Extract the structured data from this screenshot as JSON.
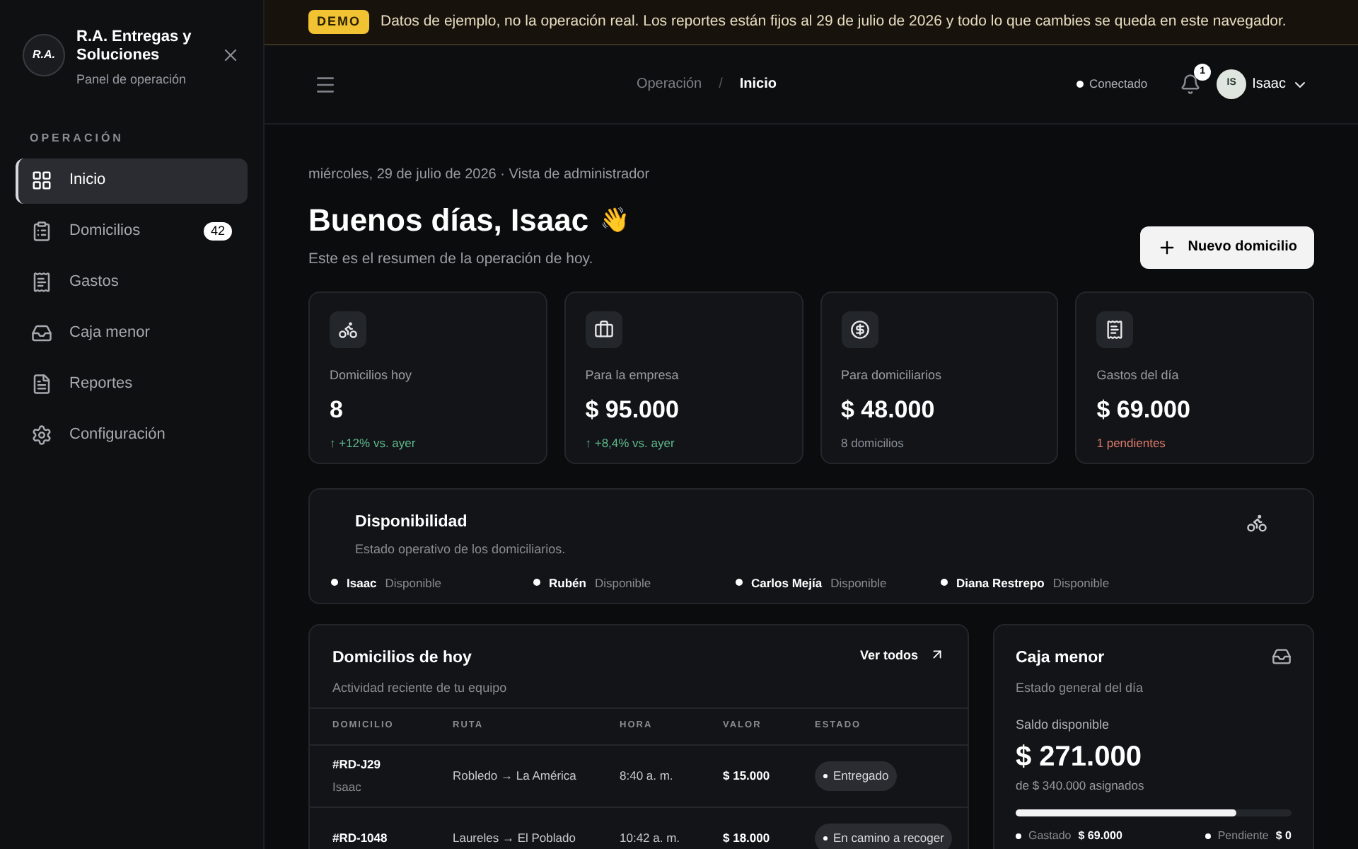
{
  "brand": {
    "name": "R.A. Entregas y Soluciones",
    "subtitle": "Panel de operación",
    "logo_text": "R.A."
  },
  "sidebar": {
    "section": "OPERACIÓN",
    "items": [
      {
        "label": "Inicio",
        "selected": true
      },
      {
        "label": "Domicilios",
        "selected": false,
        "badge": "42"
      },
      {
        "label": "Gastos",
        "selected": false
      },
      {
        "label": "Caja menor",
        "selected": false
      },
      {
        "label": "Reportes",
        "selected": false
      },
      {
        "label": "Configuración",
        "selected": false
      }
    ]
  },
  "banner": {
    "tag": "DEMO",
    "text": "Datos de ejemplo, no la operación real. Los reportes están fijos al 29 de julio de 2026 y todo lo que cambies se queda en este navegador."
  },
  "header": {
    "breadcrumb": [
      "Operación",
      "Inicio"
    ],
    "separator": "/",
    "status": "Conectado",
    "notifications": "1",
    "user_initials": "IS",
    "user_name": "Isaac"
  },
  "greeting": {
    "date": "miércoles, 29 de julio de 2026 · Vista de administrador",
    "title": "Buenos días, Isaac",
    "emoji": "👋",
    "subtitle": "Este es el resumen de la operación de hoy.",
    "button": "Nuevo domicilio"
  },
  "stats": [
    {
      "label": "Domicilios hoy",
      "value": "8",
      "note": "↑ +12% vs. ayer",
      "color": "#5fb88a"
    },
    {
      "label": "Para la empresa",
      "value": "$ 95.000",
      "note": "↑ +8,4% vs. ayer",
      "color": "#5fb88a"
    },
    {
      "label": "Para domiciliarios",
      "value": "$ 48.000",
      "note": "8 domicilios",
      "color": "#8a8f98"
    },
    {
      "label": "Gastos del día",
      "value": "$ 69.000",
      "note": "1 pendientes",
      "color": "#e07a6a"
    }
  ],
  "availability": {
    "title": "Disponibilidad",
    "subtitle": "Estado operativo de los domiciliarios.",
    "couriers": [
      {
        "name": "Isaac",
        "status": "Disponible"
      },
      {
        "name": "Rubén",
        "status": "Disponible"
      },
      {
        "name": "Carlos Mejía",
        "status": "Disponible"
      },
      {
        "name": "Diana Restrepo",
        "status": "Disponible"
      }
    ]
  },
  "deliveries": {
    "title": "Domicilios de hoy",
    "subtitle": "Actividad reciente de tu equipo",
    "link": "Ver todos",
    "columns": [
      "DOMICILIO",
      "RUTA",
      "HORA",
      "VALOR",
      "ESTADO"
    ],
    "rows": [
      {
        "id": "#RD-J29",
        "courier": "Isaac",
        "route": "Robledo → La América",
        "time": "8:40 a. m.",
        "value": "$ 15.000",
        "status": "Entregado"
      },
      {
        "id": "#RD-1048",
        "route": "Laureles → El Poblado",
        "time": "10:42 a. m.",
        "value": "$ 18.000",
        "status": "En camino a recoger"
      }
    ]
  },
  "petty_cash": {
    "title": "Caja menor",
    "subtitle": "Estado general del día",
    "balance_label": "Saldo disponible",
    "balance": "$ 271.000",
    "assigned": "de $ 340.000 asignados",
    "level": 0.8,
    "legend": [
      {
        "label": "Gastado",
        "value": "$ 69.000"
      },
      {
        "label": "Pendiente",
        "value": "$ 0"
      }
    ]
  }
}
